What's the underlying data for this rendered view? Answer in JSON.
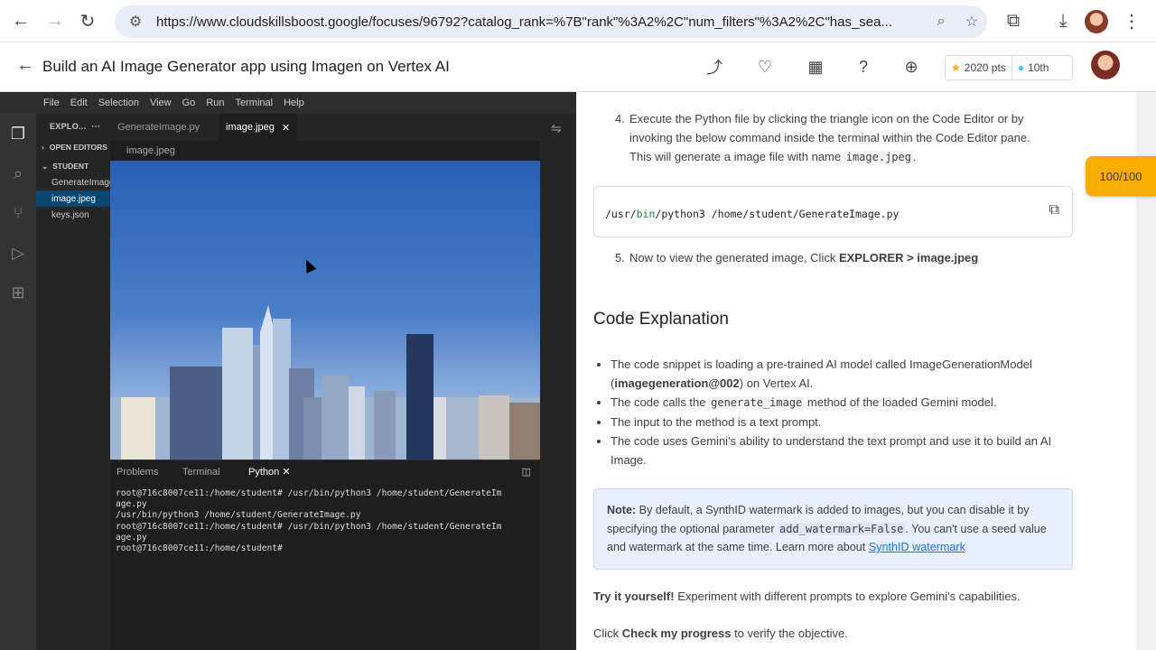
{
  "browser": {
    "url": "https://www.cloudskillsboost.google/focuses/96792?catalog_rank=%7B\"rank\"%3A2%2C\"num_filters\"%3A2%2C\"has_sea..."
  },
  "lab": {
    "title": "Build an AI Image Generator app using Imagen on Vertex AI",
    "points": "2020 pts",
    "rank": "10th",
    "score": "100/100"
  },
  "vscode": {
    "menu": [
      "File",
      "Edit",
      "Selection",
      "View",
      "Go",
      "Run",
      "Terminal",
      "Help"
    ],
    "explorer_title": "EXPLO...",
    "open_editors": "OPEN EDITORS",
    "folder": "STUDENT",
    "files": [
      "GenerateImage.py",
      "image.jpeg",
      "keys.json"
    ],
    "tabs": [
      "GenerateImage.py",
      "image.jpeg"
    ],
    "breadcrumb": "image.jpeg",
    "panel_tabs": [
      "Problems",
      "Terminal",
      "Python"
    ],
    "terminal_lines": [
      "root@716c8007ce11:/home/student# /usr/bin/python3 /home/student/GenerateIm",
      "age.py",
      "/usr/bin/python3 /home/student/GenerateImage.py",
      "root@716c8007ce11:/home/student# /usr/bin/python3 /home/student/GenerateIm",
      "age.py",
      "root@716c8007ce11:/home/student#"
    ]
  },
  "doc": {
    "step4_num": "4.",
    "step4_a": "Execute the Python file by clicking the triangle icon on the Code Editor or by invoking the below command inside the terminal within the Code Editor pane. This will generate a image file with name ",
    "step4_code": "image.jpeg",
    "step4_end": ".",
    "cmd_p1": "/usr/",
    "cmd_p2": "bin",
    "cmd_p3": "/python3 /",
    "cmd_p4": "home",
    "cmd_p5": "/student/",
    "cmd_p6": "GenerateImage.py",
    "step5_num": "5.",
    "step5_a": "Now to view the generated image, Click ",
    "step5_b": "EXPLORER > image.jpeg",
    "heading": "Code Explanation",
    "b1_a": "The code snippet is loading a pre-trained AI model called ImageGenerationModel (",
    "b1_b": "imagegeneration@002",
    "b1_c": ") on Vertex AI.",
    "b2_a": "The code calls the ",
    "b2_code": "generate_image",
    "b2_c": " method of the loaded Gemini model.",
    "b3": "The input to the method is a text prompt.",
    "b4": "The code uses Gemini's ability to understand the text prompt and use it to build an AI Image.",
    "note_label": "Note:",
    "note_a": " By default, a SynthID watermark is added to images, but you can disable it by specifying the optional parameter ",
    "note_code": "add_watermark=False",
    "note_b": ". You can't use a seed value and watermark at the same time. Learn more about ",
    "note_link": "SynthID watermark",
    "try_label": "Try it yourself!",
    "try_text": " Experiment with different prompts to explore Gemini's capabilities.",
    "check_a": "Click ",
    "check_b": "Check my progress",
    "check_c": " to verify the objective."
  },
  "colors": {
    "accent": "#f9ab00",
    "link": "#1a73e8",
    "note_bg": "#e8f0fe",
    "vscode_bg": "#1e1e1e"
  }
}
